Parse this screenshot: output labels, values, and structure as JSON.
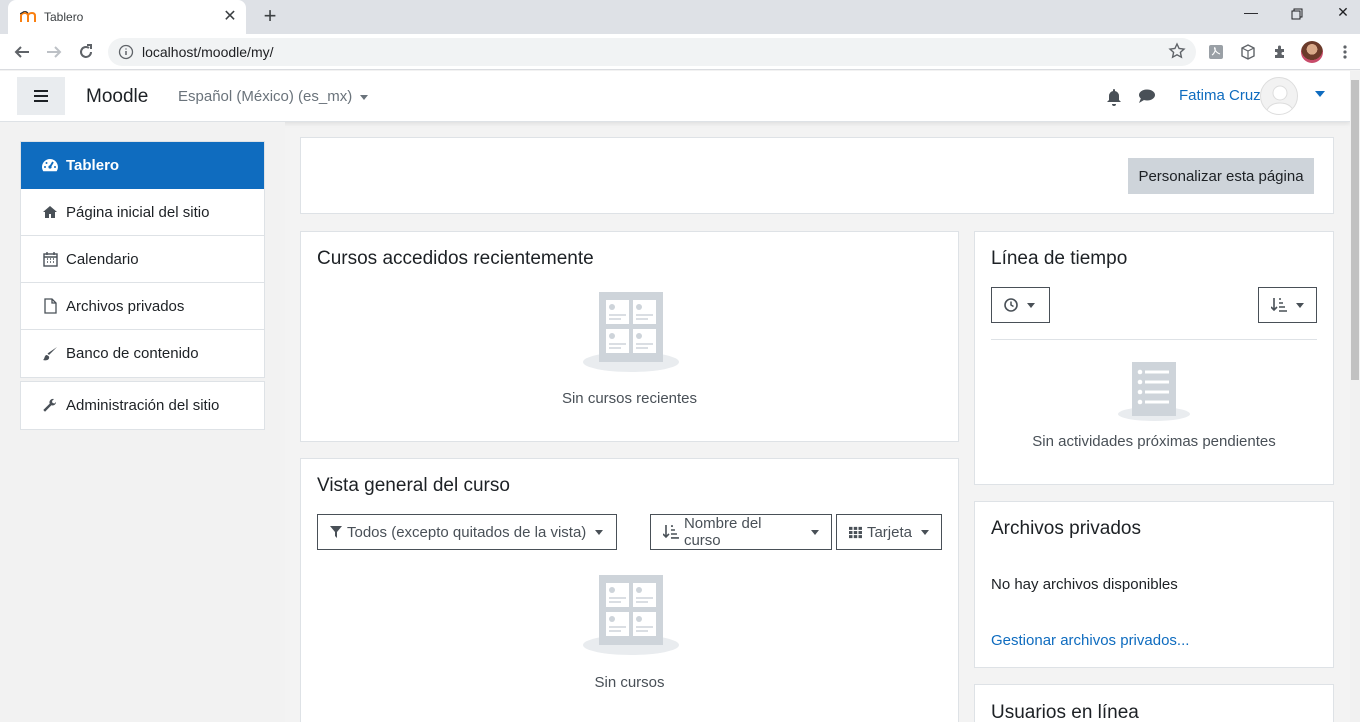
{
  "browser": {
    "tab_title": "Tablero",
    "url": "localhost/moodle/my/"
  },
  "navbar": {
    "brand": "Moodle",
    "language": "Español (México) (es_mx)",
    "username": "Fatima Cruz"
  },
  "drawer": {
    "items": [
      {
        "label": "Tablero",
        "icon": "dashboard-icon",
        "active": true
      },
      {
        "label": "Página inicial del sitio",
        "icon": "home-icon"
      },
      {
        "label": "Calendario",
        "icon": "calendar-icon"
      },
      {
        "label": "Archivos privados",
        "icon": "file-icon"
      },
      {
        "label": "Banco de contenido",
        "icon": "paintbrush-icon"
      }
    ],
    "admin_label": "Administración del sitio"
  },
  "page": {
    "customize_button": "Personalizar esta página"
  },
  "recent_courses": {
    "title": "Cursos accedidos recientemente",
    "empty": "Sin cursos recientes"
  },
  "course_overview": {
    "title": "Vista general del curso",
    "filter": "Todos (excepto quitados de la vista)",
    "sort": "Nombre del curso",
    "view": "Tarjeta",
    "empty": "Sin cursos"
  },
  "timeline": {
    "title": "Línea de tiempo",
    "empty": "Sin actividades próximas pendientes"
  },
  "private_files": {
    "title": "Archivos privados",
    "empty": "No hay archivos disponibles",
    "manage_link": "Gestionar archivos privados..."
  },
  "online_users": {
    "title": "Usuarios en línea"
  },
  "colors": {
    "primary": "#0f6cbf",
    "secondary_button": "#ced4da"
  }
}
